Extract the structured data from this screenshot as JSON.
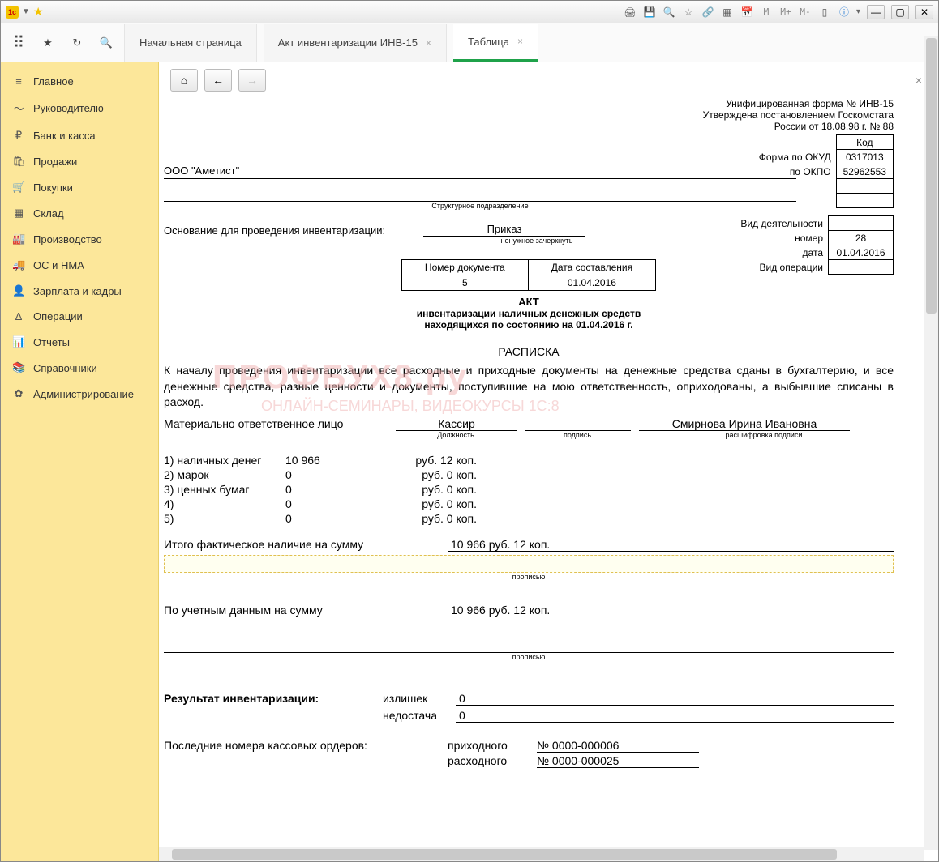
{
  "tabs": {
    "t1": "Начальная страница",
    "t2": "Акт инвентаризации ИНВ-15",
    "t3": "Таблица"
  },
  "sidebar": {
    "items": [
      {
        "icon": "≡",
        "label": "Главное"
      },
      {
        "icon": "〜",
        "label": "Руководителю"
      },
      {
        "icon": "₽",
        "label": "Банк и касса"
      },
      {
        "icon": "🛍",
        "label": "Продажи"
      },
      {
        "icon": "🛒",
        "label": "Покупки"
      },
      {
        "icon": "▦",
        "label": "Склад"
      },
      {
        "icon": "🏭",
        "label": "Производство"
      },
      {
        "icon": "🚚",
        "label": "ОС и НМА"
      },
      {
        "icon": "👤",
        "label": "Зарплата и кадры"
      },
      {
        "icon": "∆",
        "label": "Операции"
      },
      {
        "icon": "📊",
        "label": "Отчеты"
      },
      {
        "icon": "📚",
        "label": "Справочники"
      },
      {
        "icon": "✿",
        "label": "Администрирование"
      }
    ]
  },
  "doc": {
    "form_line1": "Унифицированная форма №  ИНВ-15",
    "form_line2": "Утверждена постановлением Госкомстата",
    "form_line3": "России от 18.08.98 г. № 88",
    "code_label": "Код",
    "okud_label": "Форма по ОКУД",
    "okud": "0317013",
    "okpo_label": "по ОКПО",
    "okpo": "52962553",
    "org": "ООО \"Аметист\"",
    "struct_caption": "Структурное подразделение",
    "basis_label": "Основание для проведения инвентаризации:",
    "basis_val": "Приказ",
    "basis_note": "ненужное зачеркнуть",
    "activity_label": "Вид деятельности",
    "number_label": "номер",
    "number": "28",
    "date_label": "дата",
    "date": "01.04.2016",
    "operation_label": "Вид операции",
    "docnum_h1": "Номер документа",
    "docnum_h2": "Дата составления",
    "docnum_v1": "5",
    "docnum_v2": "01.04.2016",
    "act_title": "АКТ",
    "act_sub1": "инвентаризации наличных денежных средств",
    "act_sub2": "находящихся по состоянию на 01.04.2016 г.",
    "raspiska_title": "РАСПИСКА",
    "text_block": "К началу проведения инвентаризации все расходные и приходные документы на денежные средства сданы в бухгалтерию, и все денежные средства, разные ценности и документы, поступившие на мою ответственность, оприходованы, а выбывшие списаны в расход.",
    "mol_label": "Материально ответственное лицо",
    "mol_post": "Кассир",
    "mol_name": "Смирнова Ирина Ивановна",
    "sig_post_cap": "Должность",
    "sig_sign_cap": "подпись",
    "sig_name_cap": "расшифровка подписи",
    "items": [
      {
        "n": "1) наличных денег",
        "v": "10 966",
        "r": "руб. 12 коп."
      },
      {
        "n": "2) марок",
        "v": "0",
        "r": "руб. 0 коп."
      },
      {
        "n": "3) ценных бумаг",
        "v": "0",
        "r": "руб. 0 коп."
      },
      {
        "n": "4)",
        "v": "0",
        "r": "руб. 0 коп."
      },
      {
        "n": "5)",
        "v": "0",
        "r": "руб. 0 коп."
      }
    ],
    "total_label": "Итого  фактическое  наличие  на  сумму",
    "total_val": "10 966 руб. 12 коп.",
    "prop_cap": "прописью",
    "book_label": "По  учетным  данным  на  сумму",
    "book_val": "10 966 руб. 12 коп.",
    "result_label": "Результат инвентаризации:",
    "surplus_label": "излишек",
    "surplus_val": "0",
    "shortage_label": "недостача",
    "shortage_val": "0",
    "orders_label": "Последние номера кассовых ордеров:",
    "order_in_label": "приходного",
    "order_in": "№ 0000-000006",
    "order_out_label": "расходного",
    "order_out": "№ 0000-000025"
  },
  "watermark": {
    "w1": "ПРОФБУХ8.ру",
    "w2": "ОНЛАЙН-СЕМИНАРЫ, ВИДЕОКУРСЫ 1С:8"
  }
}
